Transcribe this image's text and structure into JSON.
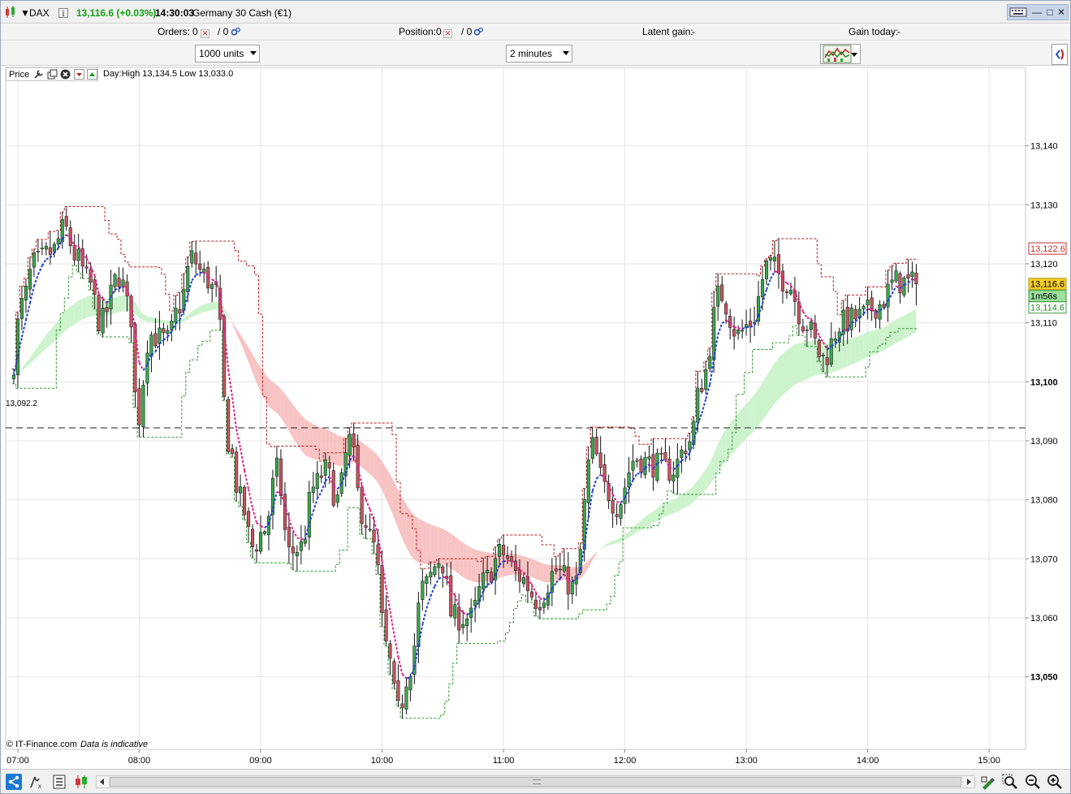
{
  "titlebar": {
    "symbol": "DAX",
    "price_change": "13,116.6 (+0.03%)",
    "time": "14:30:03",
    "instrument": "Germany 30 Cash (€1)"
  },
  "orders_bar": {
    "orders_label": "Orders:",
    "orders_value": "0",
    "orders_slash": "/ 0",
    "position_label": "Position:",
    "position_value": "0",
    "position_slash": "/ 0",
    "latent_label": "Latent gain:",
    "latent_value": "-",
    "gain_today_label": "Gain today:",
    "gain_today_value": "-"
  },
  "selectors": {
    "units": "1000 units",
    "timeframe": "2 minutes"
  },
  "chart_toolbar": {
    "price_label": "Price",
    "day_hilo": "Day:High 13,134.5 Low 13,033.0"
  },
  "footer": {
    "copyright": "© IT-Finance.com",
    "indicative": "Data is indicative"
  },
  "colors": {
    "bull_candle": "#3aa84a",
    "bear_candle": "#c9555e",
    "upper_channel": "#b32020",
    "lower_channel": "#2f9a2f",
    "ma_fast_up": "#1f3fd0",
    "ma_fast_down": "#e0208a",
    "ribbon_bear": "#f7bcbc",
    "ribbon_bull": "#c8f2c8",
    "price_current": "#f2cc2a"
  },
  "chart_data": {
    "type": "candlestick",
    "x_tick_labels": [
      "07:00",
      "08:00",
      "09:00",
      "10:00",
      "11:00",
      "12:00",
      "13:00",
      "14:00",
      "15:00"
    ],
    "y_tick_labels": [
      "13,050",
      "13,060",
      "13,070",
      "13,080",
      "13,090",
      "13,100",
      "13,110",
      "13,120",
      "13,130",
      "13,140"
    ],
    "y_ticks": [
      13050,
      13060,
      13070,
      13080,
      13090,
      13100,
      13110,
      13120,
      13130,
      13140
    ],
    "ylim": [
      13037.7,
      13153.3
    ],
    "x_range_minutes": [
      6.9,
      15.3
    ],
    "reference_line": {
      "value": 13092.2,
      "label": "13,092.2"
    },
    "price_markers": [
      {
        "label": "13,122.6",
        "value": 13122.6,
        "kind": "upper"
      },
      {
        "label": "13,116.6",
        "value": 13116.6,
        "kind": "last"
      },
      {
        "label": "1m56s",
        "value": 13114.9,
        "kind": "countdown"
      },
      {
        "label": "13,114.6",
        "value": 13114.6,
        "kind": "lower"
      }
    ],
    "candle_interval_minutes": 2,
    "price_path": [
      [
        6.95,
        13100
      ],
      [
        7.05,
        13113
      ],
      [
        7.15,
        13120
      ],
      [
        7.3,
        13122
      ],
      [
        7.4,
        13126
      ],
      [
        7.5,
        13121
      ],
      [
        7.6,
        13117
      ],
      [
        7.7,
        13110
      ],
      [
        7.85,
        13118
      ],
      [
        7.95,
        13111
      ],
      [
        8.0,
        13093
      ],
      [
        8.1,
        13108
      ],
      [
        8.25,
        13107
      ],
      [
        8.35,
        13113
      ],
      [
        8.45,
        13121
      ],
      [
        8.55,
        13118
      ],
      [
        8.65,
        13115
      ],
      [
        8.75,
        13090
      ],
      [
        8.85,
        13080
      ],
      [
        8.95,
        13072
      ],
      [
        9.05,
        13075
      ],
      [
        9.15,
        13085
      ],
      [
        9.25,
        13071
      ],
      [
        9.35,
        13072
      ],
      [
        9.45,
        13082
      ],
      [
        9.55,
        13085
      ],
      [
        9.65,
        13080
      ],
      [
        9.75,
        13090
      ],
      [
        9.85,
        13078
      ],
      [
        9.95,
        13072
      ],
      [
        10.05,
        13055
      ],
      [
        10.15,
        13044
      ],
      [
        10.25,
        13052
      ],
      [
        10.35,
        13065
      ],
      [
        10.5,
        13070
      ],
      [
        10.6,
        13060
      ],
      [
        10.75,
        13060
      ],
      [
        10.85,
        13066
      ],
      [
        11.0,
        13071
      ],
      [
        11.15,
        13067
      ],
      [
        11.3,
        13063
      ],
      [
        11.45,
        13068
      ],
      [
        11.6,
        13065
      ],
      [
        11.75,
        13089
      ],
      [
        11.85,
        13082
      ],
      [
        11.95,
        13079
      ],
      [
        12.1,
        13087
      ],
      [
        12.25,
        13086
      ],
      [
        12.4,
        13085
      ],
      [
        12.55,
        13090
      ],
      [
        12.65,
        13100
      ],
      [
        12.8,
        13115
      ],
      [
        12.95,
        13108
      ],
      [
        13.05,
        13110
      ],
      [
        13.2,
        13120
      ],
      [
        13.35,
        13117
      ],
      [
        13.5,
        13110
      ],
      [
        13.65,
        13104
      ],
      [
        13.8,
        13110
      ],
      [
        13.95,
        13111
      ],
      [
        14.1,
        13113
      ],
      [
        14.25,
        13117
      ],
      [
        14.4,
        13116.6
      ]
    ]
  }
}
